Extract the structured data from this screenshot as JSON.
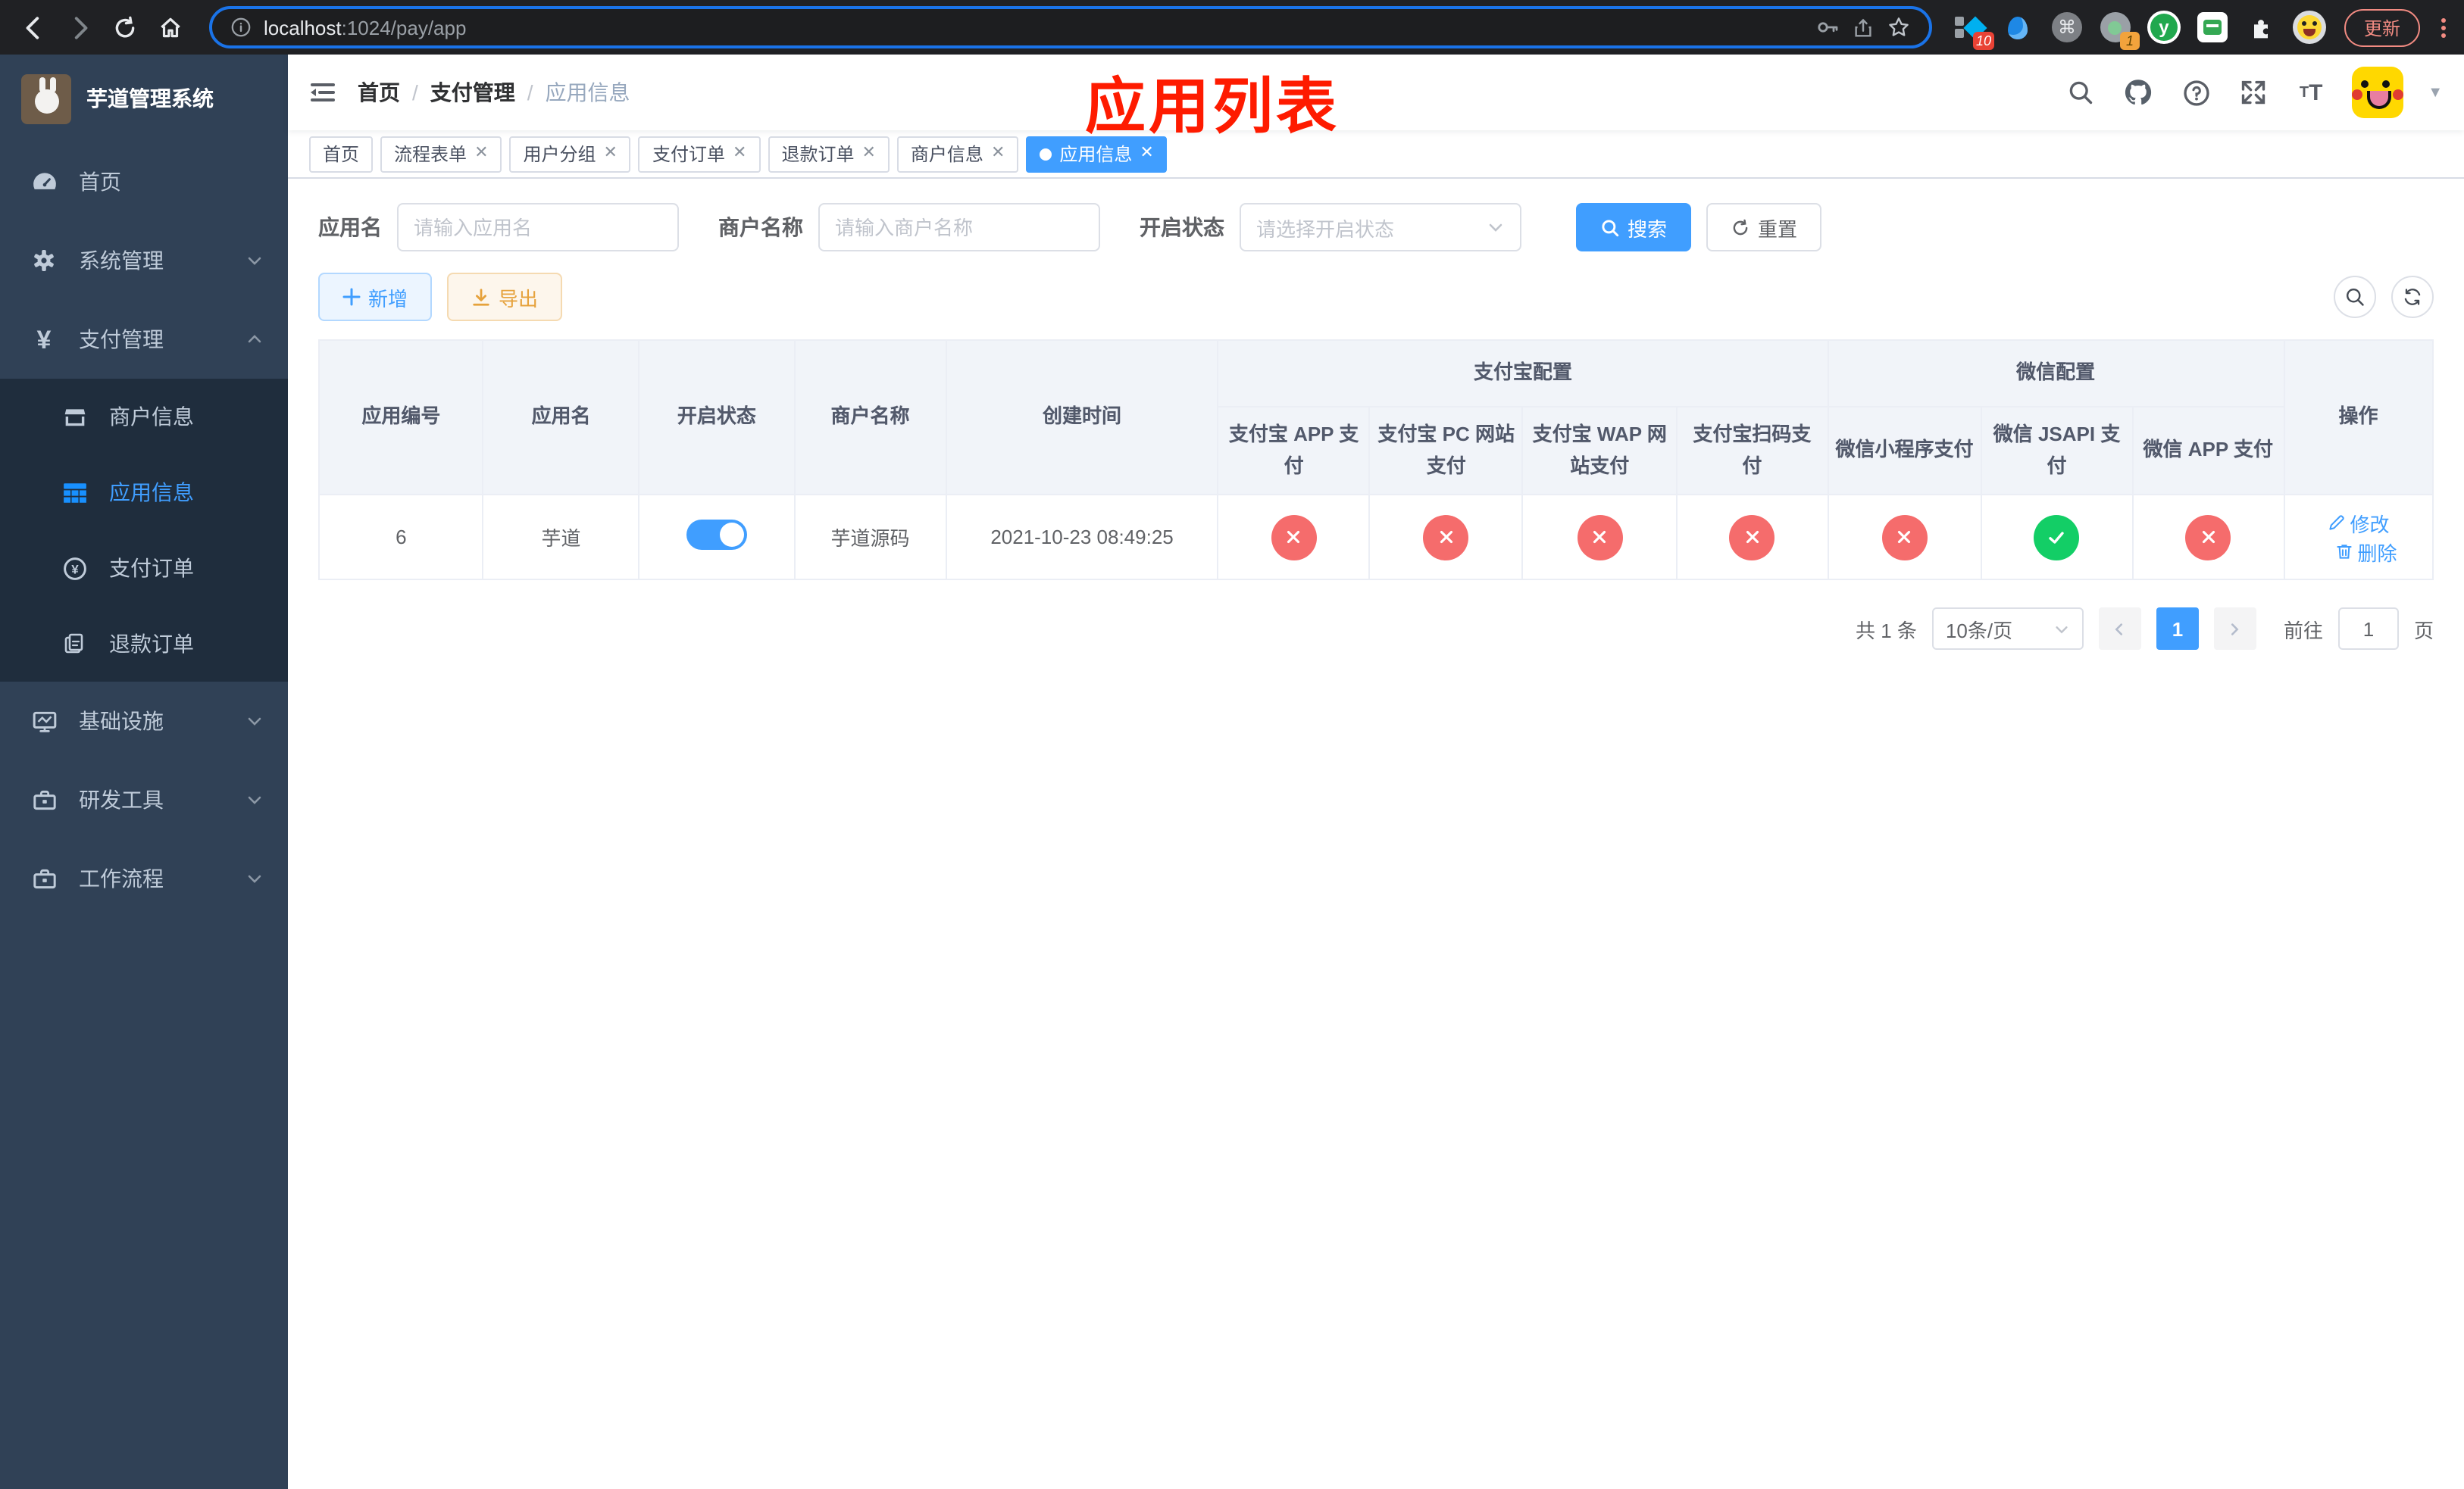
{
  "browser": {
    "url_host": "localhost",
    "url_rest": ":1024/pay/app",
    "update_label": "更新",
    "ext_badge_blue_diamond": "10",
    "ext_badge_recorder": "1"
  },
  "sidebar": {
    "title": "芋道管理系统",
    "menu": [
      {
        "label": "首页"
      },
      {
        "label": "系统管理"
      },
      {
        "label": "支付管理"
      }
    ],
    "submenu": [
      {
        "label": "商户信息"
      },
      {
        "label": "应用信息"
      },
      {
        "label": "支付订单"
      },
      {
        "label": "退款订单"
      }
    ],
    "menu_lower": [
      {
        "label": "基础设施"
      },
      {
        "label": "研发工具"
      },
      {
        "label": "工作流程"
      }
    ]
  },
  "breadcrumb": {
    "home": "首页",
    "section": "支付管理",
    "current": "应用信息"
  },
  "overlay_title": "应用列表",
  "tabs": {
    "items": [
      {
        "label": "首页"
      },
      {
        "label": "流程表单"
      },
      {
        "label": "用户分组"
      },
      {
        "label": "支付订单"
      },
      {
        "label": "退款订单"
      },
      {
        "label": "商户信息"
      },
      {
        "label": "应用信息"
      }
    ]
  },
  "filters": {
    "app_name_label": "应用名",
    "app_name_placeholder": "请输入应用名",
    "merchant_label": "商户名称",
    "merchant_placeholder": "请输入商户名称",
    "status_label": "开启状态",
    "status_placeholder": "请选择开启状态",
    "search_label": "搜索",
    "reset_label": "重置"
  },
  "toolbar": {
    "add_label": "新增",
    "export_label": "导出"
  },
  "table": {
    "headers": {
      "app_id": "应用编号",
      "app_name": "应用名",
      "open_status": "开启状态",
      "merchant_name": "商户名称",
      "created_at": "创建时间",
      "alipay_group": "支付宝配置",
      "wechat_group": "微信配置",
      "alipay_app": "支付宝 APP 支付",
      "alipay_pc": "支付宝 PC 网站支付",
      "alipay_wap": "支付宝 WAP 网站支付",
      "alipay_qr": "支付宝扫码支付",
      "wx_lite": "微信小程序支付",
      "wx_jsapi": "微信 JSAPI 支付",
      "wx_app": "微信 APP 支付",
      "ops": "操作"
    },
    "row": {
      "id": "6",
      "name": "芋道",
      "merchant": "芋道源码",
      "created_at": "2021-10-23 08:49:25",
      "statuses": [
        "no",
        "no",
        "no",
        "no",
        "no",
        "yes",
        "no"
      ],
      "edit_label": "修改",
      "delete_label": "删除"
    }
  },
  "pagination": {
    "total_text": "共 1 条",
    "page_size": "10条/页",
    "current_page": "1",
    "goto_label": "前往",
    "goto_value": "1",
    "page_label": "页"
  },
  "colors": {
    "accent": "#409eff",
    "danger": "#f56c6c",
    "success": "#13ce66",
    "warning": "#e6a23c",
    "sidebar": "#304156"
  }
}
